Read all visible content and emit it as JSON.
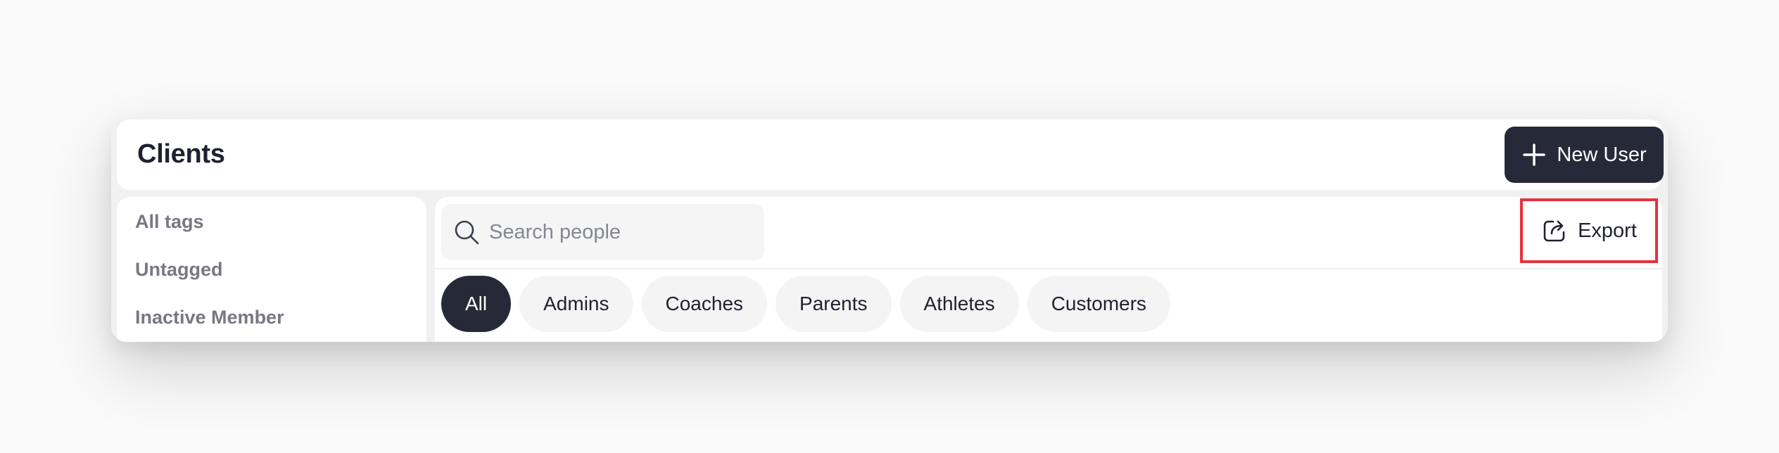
{
  "header": {
    "title": "Clients",
    "new_user_label": "New User"
  },
  "sidebar": {
    "items": [
      {
        "label": "All tags"
      },
      {
        "label": "Untagged"
      },
      {
        "label": "Inactive Member"
      }
    ]
  },
  "search": {
    "placeholder": "Search people",
    "value": ""
  },
  "export": {
    "label": "Export"
  },
  "filters": [
    {
      "label": "All",
      "active": true
    },
    {
      "label": "Admins",
      "active": false
    },
    {
      "label": "Coaches",
      "active": false
    },
    {
      "label": "Parents",
      "active": false
    },
    {
      "label": "Athletes",
      "active": false
    },
    {
      "label": "Customers",
      "active": false
    }
  ],
  "colors": {
    "primary_dark": "#262a38",
    "highlight_border": "#e5323e",
    "muted_text": "#777982"
  },
  "icons": {
    "new_user": "plus-icon",
    "search": "search-icon",
    "export": "export-icon"
  }
}
